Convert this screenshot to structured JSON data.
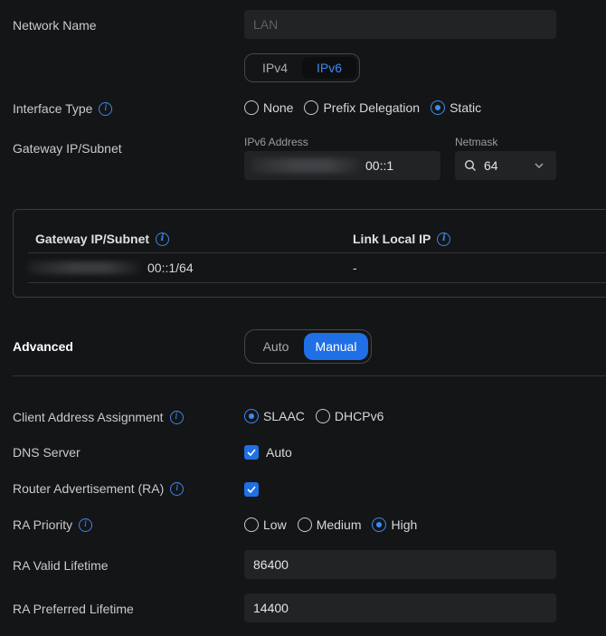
{
  "network_name": {
    "label": "Network Name",
    "value": "LAN"
  },
  "ip_version": {
    "options": [
      "IPv4",
      "IPv6"
    ],
    "selected": "IPv6"
  },
  "interface_type": {
    "label": "Interface Type",
    "options": [
      "None",
      "Prefix Delegation",
      "Static"
    ],
    "selected": "Static"
  },
  "gateway": {
    "label": "Gateway IP/Subnet",
    "ipv6_label": "IPv6 Address",
    "ipv6_value": "00::1",
    "netmask_label": "Netmask",
    "netmask_value": "64"
  },
  "table": {
    "col1": "Gateway IP/Subnet",
    "col2": "Link Local IP",
    "rows": [
      {
        "gateway": "00::1/64",
        "link_local": "-"
      }
    ]
  },
  "advanced": {
    "label": "Advanced",
    "options": [
      "Auto",
      "Manual"
    ],
    "selected": "Manual"
  },
  "client_assignment": {
    "label": "Client Address Assignment",
    "options": [
      "SLAAC",
      "DHCPv6"
    ],
    "selected": "SLAAC"
  },
  "dns": {
    "label": "DNS Server",
    "checkbox_label": "Auto",
    "checked": true
  },
  "ra": {
    "label": "Router Advertisement (RA)",
    "checked": true
  },
  "ra_priority": {
    "label": "RA Priority",
    "options": [
      "Low",
      "Medium",
      "High"
    ],
    "selected": "High"
  },
  "ra_valid": {
    "label": "RA Valid Lifetime",
    "value": "86400"
  },
  "ra_preferred": {
    "label": "RA Preferred Lifetime",
    "value": "14400"
  },
  "colors": {
    "accent": "#1f6fe5",
    "accent_text": "#3d8bf0",
    "background": "#141517"
  }
}
